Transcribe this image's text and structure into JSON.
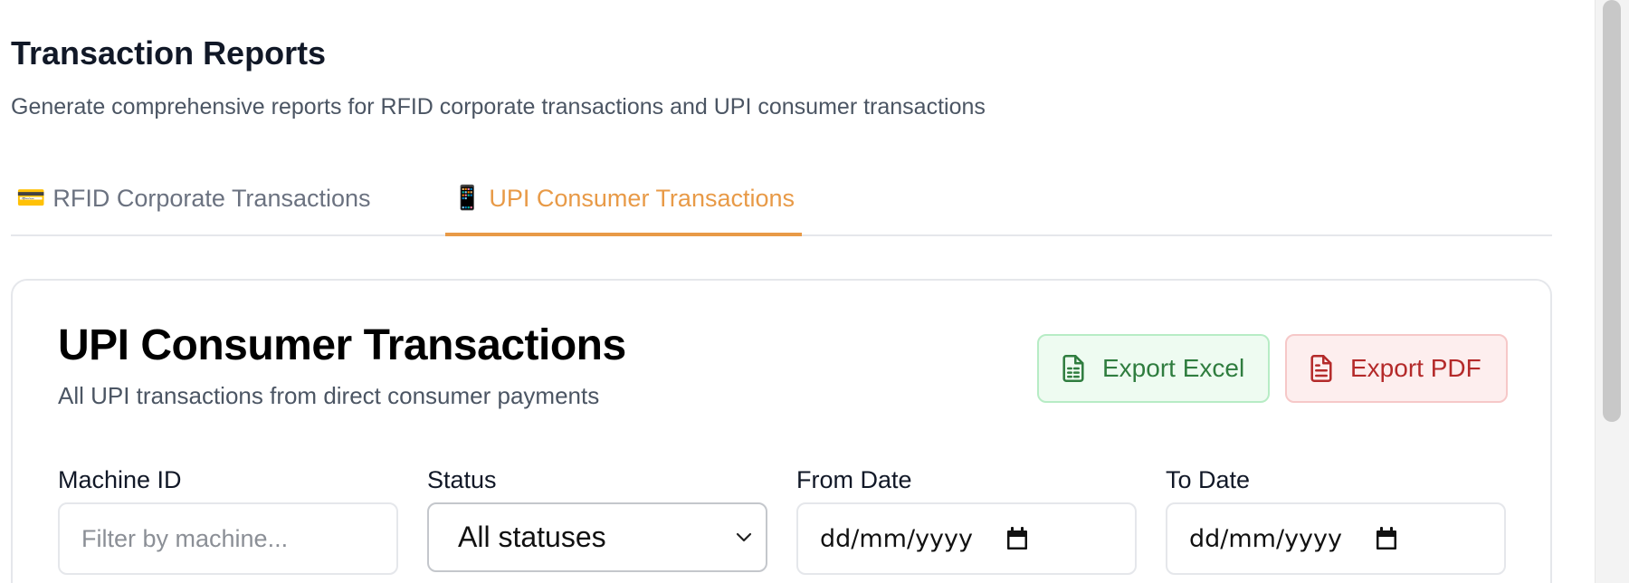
{
  "page": {
    "title": "Transaction Reports",
    "subtitle": "Generate comprehensive reports for RFID corporate transactions and UPI consumer transactions"
  },
  "tabs": [
    {
      "icon": "💳",
      "icon_name": "credit-card-icon",
      "label": "RFID Corporate Transactions",
      "active": false
    },
    {
      "icon": "📱",
      "icon_name": "mobile-phone-icon",
      "label": "UPI Consumer Transactions",
      "active": true
    }
  ],
  "card": {
    "title": "UPI Consumer Transactions",
    "subtitle": "All UPI transactions from direct consumer payments",
    "export_excel_label": "Export Excel",
    "export_pdf_label": "Export PDF"
  },
  "filters": {
    "machine_id": {
      "label": "Machine ID",
      "placeholder": "Filter by machine...",
      "value": ""
    },
    "status": {
      "label": "Status",
      "selected": "All statuses"
    },
    "from_date": {
      "label": "From Date",
      "value": "dd/mm/yyyy"
    },
    "to_date": {
      "label": "To Date",
      "value": "dd/mm/yyyy"
    }
  },
  "colors": {
    "accent": "#e89a47",
    "excel": "#2f7d3f",
    "pdf": "#b42a2a"
  }
}
